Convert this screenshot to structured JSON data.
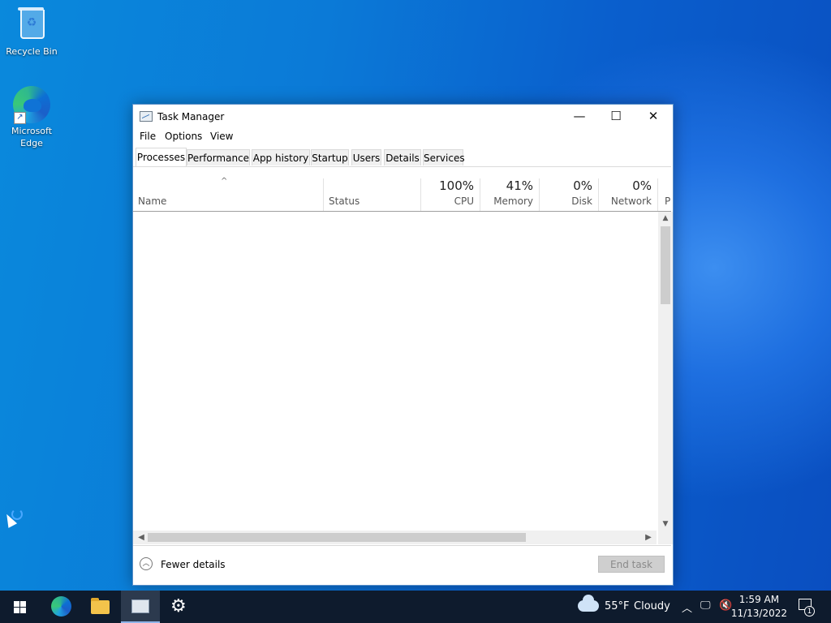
{
  "desktop": {
    "icons": [
      {
        "label": "Recycle Bin",
        "icon": "recycle-bin-icon"
      },
      {
        "label": "Microsoft Edge",
        "icon": "edge-icon"
      }
    ]
  },
  "window": {
    "title": "Task Manager",
    "buttons": {
      "minimize": "—",
      "maximize": "☐",
      "close": "✕"
    },
    "menu": [
      "File",
      "Options",
      "View"
    ],
    "tabs": [
      "Processes",
      "Performance",
      "App history",
      "Startup",
      "Users",
      "Details",
      "Services"
    ],
    "active_tab": "Processes",
    "sort_caret": "^",
    "columns": {
      "name": "Name",
      "status": "Status",
      "cpu": {
        "pct": "100%",
        "label": "CPU"
      },
      "memory": {
        "pct": "41%",
        "label": "Memory"
      },
      "disk": {
        "pct": "0%",
        "label": "Disk"
      },
      "network": {
        "pct": "0%",
        "label": "Network"
      },
      "power": {
        "label": "P"
      }
    },
    "footer": {
      "fewer_details": "Fewer details",
      "end_task": "End task"
    }
  },
  "taskbar": {
    "weather": {
      "temp": "55°F",
      "condition": "Cloudy"
    },
    "clock": {
      "time": "1:59 AM",
      "date": "11/13/2022"
    },
    "notifications_count": "1"
  }
}
